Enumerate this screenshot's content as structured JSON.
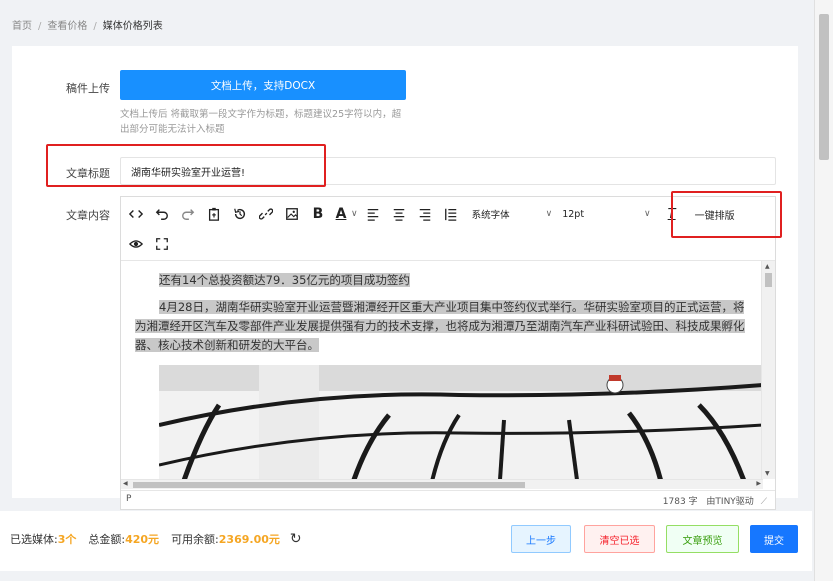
{
  "breadcrumb": [
    "首页",
    "查看价格",
    "媒体价格列表"
  ],
  "form": {
    "upload_label": "稿件上传",
    "upload_button": "文档上传，支持DOCX",
    "upload_hint": "文档上传后 将截取第一段文字作为标题，标题建议25字符以内，超出部分可能无法计入标题",
    "title_label": "文章标题",
    "title_value": "湖南华研实验室开业运营!",
    "content_label": "文章内容"
  },
  "toolbar": {
    "font_family": "系统字体",
    "font_size": "12pt",
    "one_click_format": "一键排版",
    "icons": [
      "code-view-icon",
      "undo-icon",
      "redo-icon",
      "paste-text-icon",
      "history-icon",
      "link-icon",
      "image-icon",
      "bold-icon",
      "font-color-icon",
      "align-left-icon",
      "align-center-icon",
      "align-right-icon",
      "line-height-icon",
      "clear-format-icon",
      "preview-icon",
      "fullscreen-icon"
    ]
  },
  "editor": {
    "paragraph1": "还有14个总投资额达79．35亿元的项目成功签约",
    "paragraph2": "4月28日，湖南华研实验室开业运营暨湘潭经开区重大产业项目集中签约仪式举行。华研实验室项目的正式运营，将为湘潭经开区汽车及零部件产业发展提供强有力的技术支撑，也将成为湘潭乃至湖南汽车产业科研试验田、科技成果孵化器、核心技术创新和研发的大平台。",
    "status_path": "P",
    "word_count": "1783 字",
    "powered_by": "由TINY驱动"
  },
  "footer": {
    "selected_label": "已选媒体:",
    "selected_value": "3个",
    "total_label": "总金额:",
    "total_value": "420元",
    "balance_label": "可用余额:",
    "balance_value": "2369.00元",
    "prev_button": "上一步",
    "clear_button": "清空已选",
    "preview_button": "文章预览",
    "submit_button": "提交"
  },
  "colors": {
    "primary": "#1677ff",
    "upload_button": "#1890ff",
    "highlight_red": "#e02020",
    "amount_orange": "#f5a623"
  }
}
